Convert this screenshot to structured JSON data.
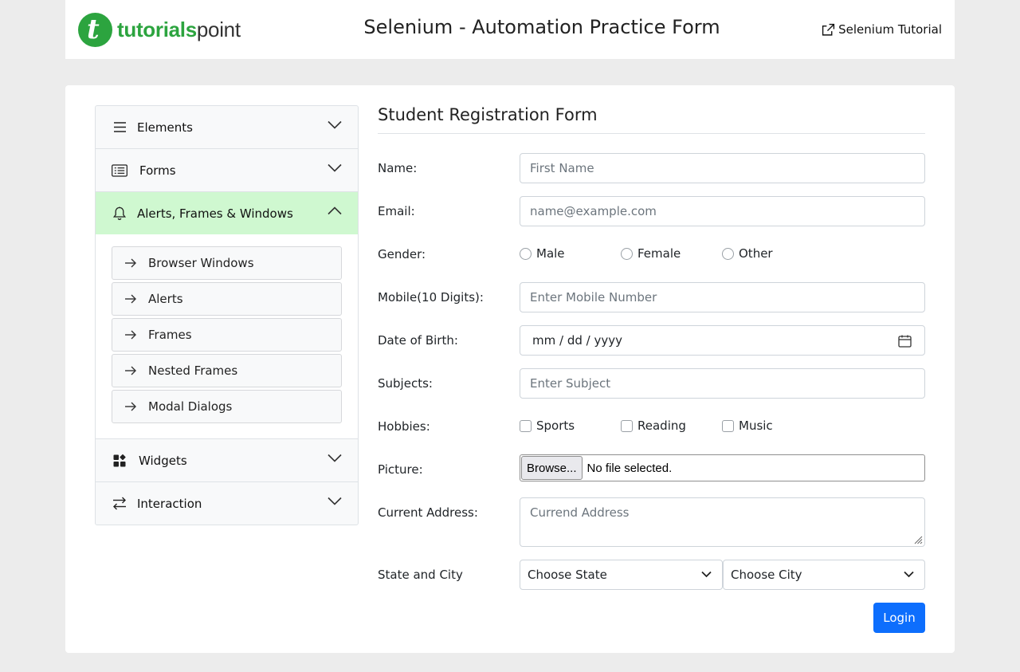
{
  "header": {
    "logo_part1": "tutorials",
    "logo_part2": "point",
    "title": "Selenium - Automation Practice Form",
    "tutorial_link": "Selenium Tutorial"
  },
  "sidebar": {
    "items": [
      {
        "label": "Elements",
        "icon": "menu-icon"
      },
      {
        "label": "Forms",
        "icon": "list-icon"
      },
      {
        "label": "Alerts, Frames & Windows",
        "icon": "bell-icon",
        "expanded": true
      },
      {
        "label": "Widgets",
        "icon": "widgets-icon"
      },
      {
        "label": "Interaction",
        "icon": "arrows-swap-icon"
      }
    ],
    "subitems": [
      "Browser Windows",
      "Alerts",
      "Frames",
      "Nested Frames",
      "Modal Dialogs"
    ]
  },
  "form": {
    "title": "Student Registration Form",
    "name_label": "Name:",
    "name_placeholder": "First Name",
    "email_label": "Email:",
    "email_placeholder": "name@example.com",
    "gender_label": "Gender:",
    "gender_options": [
      "Male",
      "Female",
      "Other"
    ],
    "mobile_label": "Mobile(10 Digits):",
    "mobile_placeholder": "Enter Mobile Number",
    "dob_label": "Date of Birth:",
    "dob_value": "mm / dd / yyyy",
    "subjects_label": "Subjects:",
    "subjects_placeholder": "Enter Subject",
    "hobbies_label": "Hobbies:",
    "hobby_options": [
      "Sports",
      "Reading",
      "Music"
    ],
    "picture_label": "Picture:",
    "browse_button": "Browse...",
    "file_status": "No file selected.",
    "address_label": "Current Address:",
    "address_placeholder": "Currend Address",
    "state_city_label": "State and City",
    "state_select": "Choose State",
    "city_select": "Choose City",
    "login_button": "Login"
  },
  "colors": {
    "brand": "#2ca43f",
    "active_accordion": "#cff8d0",
    "primary_button": "#0d6efd"
  }
}
